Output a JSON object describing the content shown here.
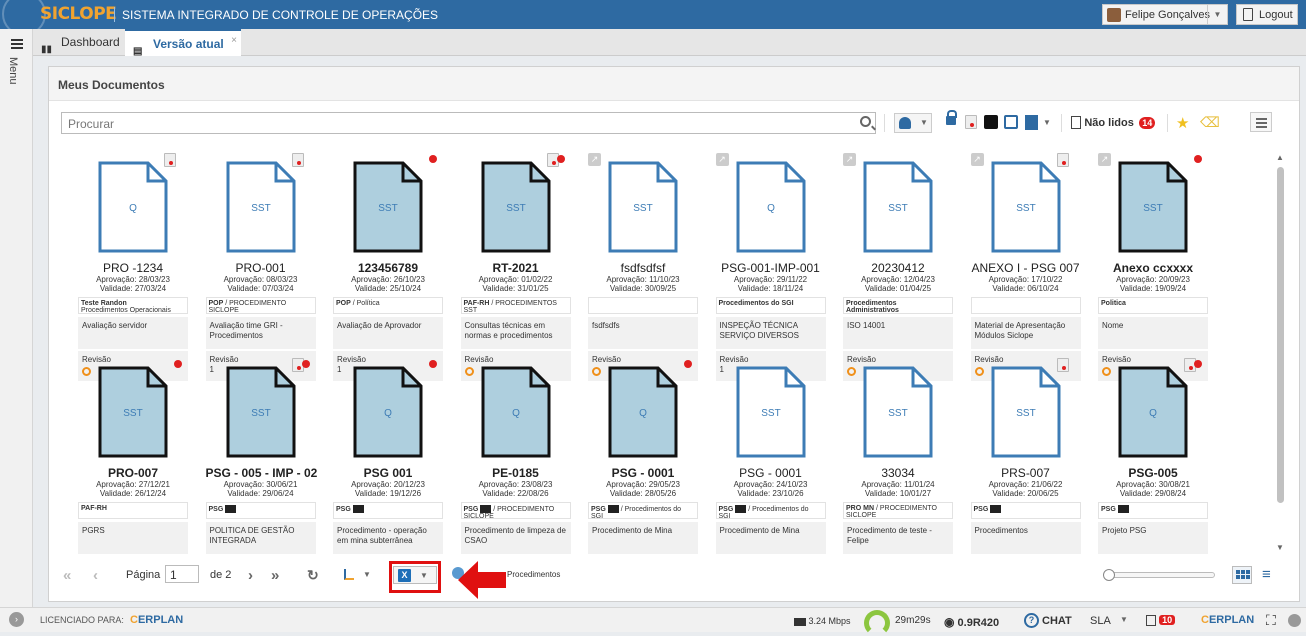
{
  "header": {
    "logo": "SICLOPE",
    "system_title": "SISTEMA INTEGRADO DE CONTROLE DE OPERAÇÕES",
    "user_name": "Felipe Gonçalves",
    "logout_label": "Logout"
  },
  "sidebar": {
    "menu_label": "Menu"
  },
  "tabs": [
    {
      "label": "Dashboard"
    },
    {
      "label": "Versão atual"
    }
  ],
  "panel": {
    "title": "Meus Documentos",
    "search_placeholder": "Procurar",
    "unread_label": "Não lidos",
    "unread_count": "14"
  },
  "documents": [
    {
      "code": "PRO -1234",
      "bold": false,
      "filled": false,
      "letter": "Q",
      "approval": "Aprovação: 28/03/23",
      "validity": "Validade: 27/03/24",
      "tag1": "Teste Randon",
      "tag2": "Procedimentos Operacionais",
      "desc": "Avaliação servidor",
      "rev": "Revisão",
      "rev_num": "",
      "circle": true
    },
    {
      "code": "PRO-001",
      "bold": false,
      "filled": false,
      "letter": "SST",
      "approval": "Aprovação: 08/03/23",
      "validity": "Validade: 07/03/24",
      "tag1": "POP",
      "tag2": "SICLOPE",
      "tag3": "PROCEDIMENTO",
      "desc": "Avaliação time GRI - Procedimentos",
      "rev": "Revisão",
      "rev_num": "1",
      "circle": false
    },
    {
      "code": "123456789",
      "bold": true,
      "filled": true,
      "letter": "SST",
      "approval": "Aprovação: 26/10/23",
      "validity": "Validade: 25/10/24",
      "tag1": "POP",
      "tag3": "Política",
      "desc": "Avaliação de Aprovador",
      "rev": "Revisão",
      "rev_num": "1",
      "circle": false
    },
    {
      "code": "RT-2021",
      "bold": true,
      "filled": true,
      "letter": "SST",
      "approval": "Aprovação: 01/02/22",
      "validity": "Validade: 31/01/25",
      "tag1": "PAF-RH",
      "tag2": "SST",
      "tag3": "PROCEDIMENTOS",
      "desc": "Consultas técnicas em normas e procedimentos",
      "rev": "Revisão",
      "rev_num": "",
      "circle": true
    },
    {
      "code": "fsdfsdfsf",
      "bold": false,
      "filled": false,
      "letter": "SST",
      "approval": "Aprovação: 11/10/23",
      "validity": "Validade: 30/09/25",
      "tag1": "",
      "desc": "fsdfsdfs",
      "rev": "Revisão",
      "rev_num": "",
      "circle": true
    },
    {
      "code": "PSG-001-IMP-001",
      "bold": false,
      "filled": false,
      "letter": "Q",
      "approval": "Aprovação: 29/11/22",
      "validity": "Validade: 18/11/24",
      "tag1": "Procedimentos do SGI",
      "desc": "INSPEÇÃO TÉCNICA SERVIÇO DIVERSOS",
      "rev": "Revisão",
      "rev_num": "1",
      "circle": false
    },
    {
      "code": "20230412",
      "bold": false,
      "filled": false,
      "letter": "SST",
      "approval": "Aprovação: 12/04/23",
      "validity": "Validade: 01/04/25",
      "tag1": "Procedimentos Administrativos",
      "desc": "ISO 14001",
      "rev": "Revisão",
      "rev_num": "",
      "circle": true
    },
    {
      "code": "ANEXO I - PSG 007",
      "bold": false,
      "filled": false,
      "letter": "SST",
      "approval": "Aprovação: 17/10/22",
      "validity": "Validade: 06/10/24",
      "tag1": "",
      "desc": "Material de Apresentação Módulos Siclope",
      "rev": "Revisão",
      "rev_num": "",
      "circle": true
    },
    {
      "code": "Anexo ccxxxx",
      "bold": true,
      "filled": true,
      "letter": "SST",
      "approval": "Aprovação: 20/09/23",
      "validity": "Validade: 19/09/24",
      "tag1": "Politica",
      "desc": "Nome",
      "rev": "Revisão",
      "rev_num": "",
      "circle": true
    },
    {
      "code": "PRO-007",
      "bold": true,
      "filled": true,
      "letter": "SST",
      "approval": "Aprovação: 27/12/21",
      "validity": "Validade: 26/12/24",
      "tag1": "PAF-RH",
      "desc": "PGRS"
    },
    {
      "code": "PSG - 005 - IMP - 02",
      "bold": true,
      "filled": true,
      "letter": "SST",
      "approval": "Aprovação: 30/06/21",
      "validity": "Validade: 29/06/24",
      "tag1": "PSG",
      "pulse": true,
      "desc": "POLITICA DE GESTÃO INTEGRADA"
    },
    {
      "code": "PSG 001",
      "bold": true,
      "filled": true,
      "letter": "Q",
      "approval": "Aprovação: 20/12/23",
      "validity": "Validade: 19/12/26",
      "tag1": "PSG",
      "pulse": true,
      "desc": "Procedimento - operação em mina subterrânea"
    },
    {
      "code": "PE-0185",
      "bold": true,
      "filled": true,
      "letter": "Q",
      "approval": "Aprovação: 23/08/23",
      "validity": "Validade: 22/08/26",
      "tag1": "PSG",
      "pulse": true,
      "tag2": "SICLOPE",
      "tag3": "PROCEDIMENTO",
      "desc": "Procedimento de limpeza de CSAO"
    },
    {
      "code": "PSG - 0001",
      "bold": true,
      "filled": true,
      "letter": "Q",
      "approval": "Aprovação: 29/05/23",
      "validity": "Validade: 28/05/26",
      "tag1": "PSG",
      "pulse": true,
      "tag3": "Procedimentos do SGI",
      "desc": "Procedimento de Mina"
    },
    {
      "code": "PSG - 0001",
      "bold": false,
      "filled": false,
      "letter": "SST",
      "approval": "Aprovação: 24/10/23",
      "validity": "Validade: 23/10/26",
      "tag1": "PSG",
      "pulse": true,
      "tag3": "Procedimentos do SGI",
      "desc": "Procedimento de Mina"
    },
    {
      "code": "33034",
      "bold": false,
      "filled": false,
      "letter": "SST",
      "approval": "Aprovação: 11/01/24",
      "validity": "Validade: 10/01/27",
      "tag1": "PRO MN",
      "tag2": "SICLOPE",
      "tag3": "PROCEDIMENTO",
      "desc": "Procedimento de teste - Felipe"
    },
    {
      "code": "PRS-007",
      "bold": false,
      "filled": false,
      "letter": "SST",
      "approval": "Aprovação: 21/06/22",
      "validity": "Validade: 20/06/25",
      "tag1": "PSG",
      "pulse": true,
      "desc": "Procedimentos"
    },
    {
      "code": "PSG-005",
      "bold": true,
      "filled": true,
      "letter": "Q",
      "approval": "Aprovação: 30/08/21",
      "validity": "Validade: 29/08/24",
      "tag1": "PSG",
      "pulse": true,
      "desc": "Projeto PSG"
    }
  ],
  "pager": {
    "page_label": "Página",
    "page_value": "1",
    "of_label": "de 2",
    "export_label": "Procedimentos",
    "excel_icon_label": "X"
  },
  "footer": {
    "licensed_label": "LICENCIADO PARA:",
    "erp_brand": "ERPLAN",
    "speed": "3.24 Mbps",
    "timer": "29m29s",
    "version": "0.9R420",
    "chat_label": "CHAT",
    "sla_label": "SLA",
    "notif_count": "10"
  },
  "colors": {
    "brand_blue": "#2e6aa2",
    "accent_orange": "#f0a330",
    "doc_fill": "#aecfde",
    "doc_stroke": "#3d7cb5",
    "alert_red": "#e02020"
  }
}
